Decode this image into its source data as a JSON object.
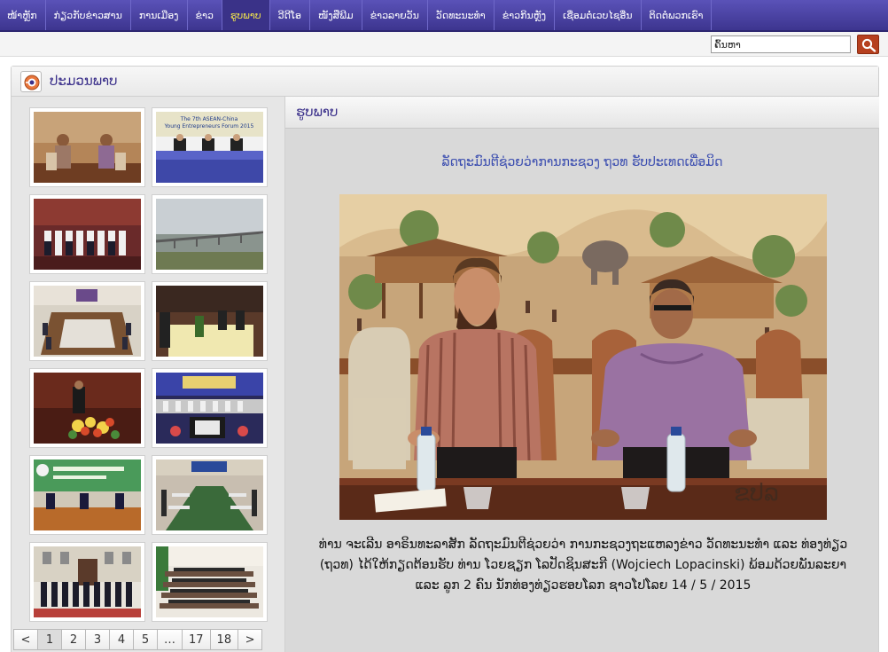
{
  "nav": {
    "items": [
      {
        "label": "ໜ້າຫຼັກ",
        "active": false
      },
      {
        "label": "ກ່ຽວກັບຂ່າວສານ",
        "active": false
      },
      {
        "label": "ການເມືອງ",
        "active": false
      },
      {
        "label": "ຂ່າວ",
        "active": false
      },
      {
        "label": "ຮູບພາບ",
        "active": true
      },
      {
        "label": "ວີດີໂອ",
        "active": false
      },
      {
        "label": "ໜັງສືພີມ",
        "active": false
      },
      {
        "label": "ຂ່າວລາຍວັນ",
        "active": false
      },
      {
        "label": "ວັດທະນະທຳ",
        "active": false
      },
      {
        "label": "ຂ່າວກິນຫຼັງ",
        "active": false
      },
      {
        "label": "ເຊື່ອມຕໍ່ເວບໄຊອື່ນ",
        "active": false
      },
      {
        "label": "ຕິດຕໍ່ພວກເຮົາ",
        "active": false
      }
    ]
  },
  "search": {
    "value": "ຄົ້ນຫາ"
  },
  "panel": {
    "title": "ປະມວນພາບ"
  },
  "thumbnails": [
    {
      "name": "thumb-meeting-seated",
      "caption": ""
    },
    {
      "name": "thumb-asean-china-forum",
      "caption": "The 7th ASEAN-China Young Entrepreneurs Forum 2015"
    },
    {
      "name": "thumb-group-photo",
      "caption": ""
    },
    {
      "name": "thumb-bridge",
      "caption": ""
    },
    {
      "name": "thumb-conference-room",
      "caption": ""
    },
    {
      "name": "thumb-signing-table",
      "caption": ""
    },
    {
      "name": "thumb-speech-flowers",
      "caption": ""
    },
    {
      "name": "thumb-ceremony-hall",
      "caption": ""
    },
    {
      "name": "thumb-green-banner",
      "caption": ""
    },
    {
      "name": "thumb-large-meeting",
      "caption": ""
    },
    {
      "name": "thumb-building-group",
      "caption": ""
    },
    {
      "name": "thumb-auditorium",
      "caption": ""
    }
  ],
  "pagination": {
    "prev": "<",
    "pages": [
      "1",
      "2",
      "3",
      "4",
      "5",
      "…",
      "17",
      "18"
    ],
    "current": "1",
    "next": ">"
  },
  "content": {
    "section_title": "ຮູບພາບ",
    "headline": "ລັດຖະມົນຕີຊ່ວຍວ່າການກະຊວງ ຖວທ ຮັບປະເທດເພື່ອມິດ",
    "watermark": "ຂປລ",
    "caption": "ທ່ານ ຈະເລີນ ອາຣິນທະລາສັກ ລັດຖະມົນຕີຊ່ວຍວ່າ ການກະຊວງຖະແຫລງຂ່າວ ວັດທະນະທຳ ແລະ ທ່ອງທ່ຽວ (ຖວທ) ໄດ້ໃຫ້ກຽດຕ້ອນຮັບ ທ່ານ ໂວຍຊຽກ ໂລປັດຊິນສະກີ (Wojciech Lopacinski) ພ້ອມດ້ວຍພັນລະຍາ ແລະ ລູກ 2 ຄົນ ນັກທ່ອງທ່ຽວຮອບໂລກ ຊາວໂປໂລຍ 14 / 5 / 2015"
  },
  "colors": {
    "nav_bg": "#4a42a8",
    "nav_active_text": "#f3e64b",
    "title_text": "#3a2f8a",
    "headline_text": "#3d4fb0",
    "search_button": "#b6401f"
  }
}
